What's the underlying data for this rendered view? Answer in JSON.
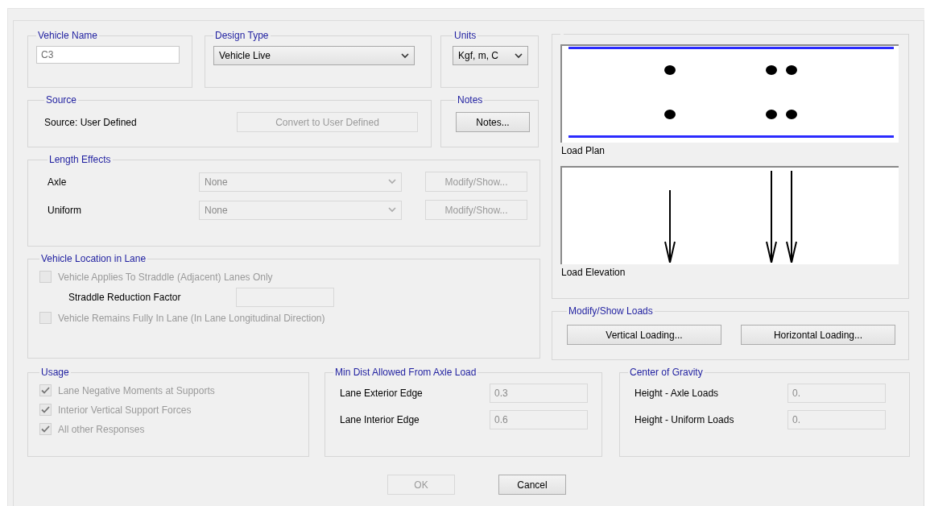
{
  "vehicle_name": {
    "label": "Vehicle Name",
    "value": "C3"
  },
  "design_type": {
    "label": "Design Type",
    "value": "Vehicle Live"
  },
  "units": {
    "label": "Units",
    "value": "Kgf, m, C"
  },
  "source": {
    "label": "Source",
    "text": "Source: User Defined",
    "button": {
      "label": "Convert to User Defined",
      "disabled": true
    }
  },
  "notes": {
    "label": "Notes",
    "button": {
      "label": "Notes...",
      "disabled": false
    }
  },
  "length_effects": {
    "label": "Length Effects",
    "rows": [
      {
        "label": "Axle",
        "value": "None",
        "button": "Modify/Show...",
        "disabled": true
      },
      {
        "label": "Uniform",
        "value": "None",
        "button": "Modify/Show...",
        "disabled": true
      }
    ]
  },
  "vehicle_location": {
    "label": "Vehicle Location in Lane",
    "straddle": {
      "label": "Vehicle Applies To Straddle (Adjacent) Lanes Only",
      "checked": false,
      "disabled": true
    },
    "factor_label": "Straddle Reduction Factor",
    "remains": {
      "label": "Vehicle Remains Fully In Lane (In Lane Longitudinal Direction)",
      "checked": false,
      "disabled": true
    }
  },
  "preview": {
    "plan_caption": "Load Plan",
    "elevation_caption": "Load Elevation"
  },
  "loads": {
    "label": "Modify/Show Loads",
    "buttons": [
      "Vertical Loading...",
      "Horizontal Loading..."
    ]
  },
  "usage": {
    "label": "Usage",
    "items": [
      {
        "label": "Lane Negative Moments at Supports",
        "checked": true,
        "disabled": true
      },
      {
        "label": "Interior Vertical Support Forces",
        "checked": true,
        "disabled": true
      },
      {
        "label": "All other Responses",
        "checked": true,
        "disabled": true
      }
    ]
  },
  "min_dist": {
    "label": "Min Dist Allowed From Axle Load",
    "fields": [
      {
        "label": "Lane Exterior Edge",
        "value": "0.3",
        "disabled": true
      },
      {
        "label": "Lane Interior Edge",
        "value": "0.6",
        "disabled": true
      }
    ]
  },
  "center_of_gravity": {
    "label": "Center of Gravity",
    "fields": [
      {
        "label": "Height - Axle Loads",
        "value": "0.",
        "disabled": true
      },
      {
        "label": "Height - Uniform Loads",
        "value": "0.",
        "disabled": true
      }
    ]
  },
  "buttons": [
    {
      "label": "OK",
      "disabled": true
    },
    {
      "label": "Cancel",
      "disabled": false
    }
  ]
}
